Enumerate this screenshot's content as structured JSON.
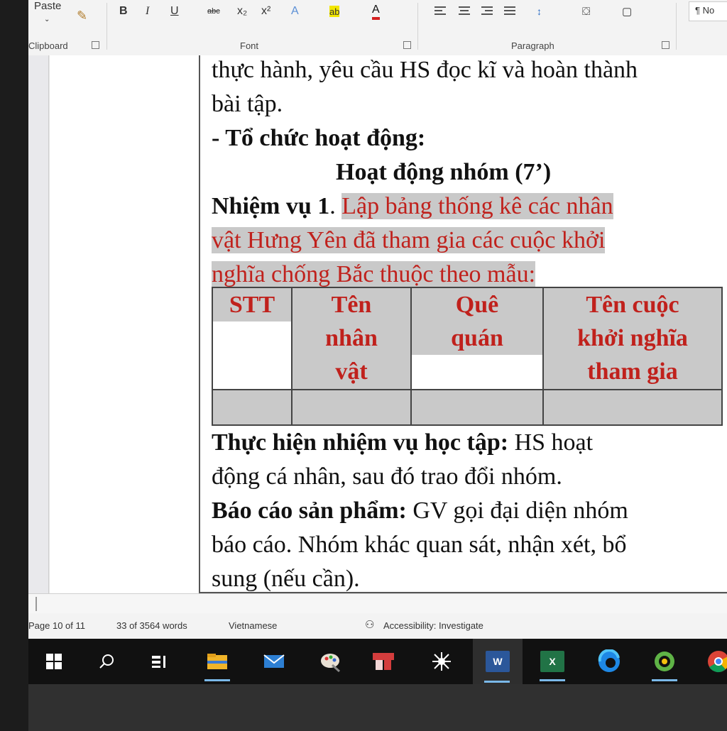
{
  "ribbon": {
    "paste_label": "Paste",
    "font_buttons": [
      "B",
      "I",
      "U",
      "abc",
      "x₂",
      "x²",
      "A",
      "ab",
      "A"
    ],
    "groups": {
      "clipboard": "Clipboard",
      "font": "Font",
      "paragraph": "Paragraph"
    },
    "styles_fragment": "¶ No"
  },
  "document": {
    "lines": [
      "thực hành, yêu cầu HS đọc kĩ và hoàn thành",
      "bài tập.",
      "- Tổ chức hoạt động:",
      "Hoạt động nhóm (7’)"
    ],
    "task_label": "Nhiệm vụ 1",
    "task_label_dot": ". ",
    "task_text_lines": [
      "Lập bảng thống kê các nhân",
      "vật Hưng Yên đã tham gia các cuộc khởi",
      "nghĩa chống Bắc thuộc theo mẫu:"
    ],
    "table": {
      "headers": [
        [
          "STT"
        ],
        [
          "Tên",
          "nhân",
          "vật"
        ],
        [
          "Quê",
          "quán"
        ],
        [
          "Tên cuộc",
          "khởi nghĩa",
          "tham gia"
        ]
      ]
    },
    "perform_label": "Thực hiện nhiệm vụ học tập:",
    "perform_text": " HS hoạt",
    "perform_text_2": "động cá nhân, sau đó trao đổi nhóm.",
    "report_label": "Báo cáo sản phẩm:",
    "report_text": " GV gọi đại diện nhóm",
    "report_text_2": "báo cáo. Nhóm khác quan sát, nhận xét, bổ",
    "report_text_3": "sung (nếu cần)."
  },
  "status_bar": {
    "page": "Page 10 of 11",
    "words": "33 of 3564 words",
    "language": "Vietnamese",
    "accessibility": "Accessibility: Investigate"
  },
  "taskbar": {
    "items": [
      "start-icon",
      "search-icon",
      "task-view-icon",
      "file-explorer-icon",
      "mail-icon",
      "paint-icon",
      "snipping-icon",
      "settings-burst-icon",
      "word-icon",
      "excel-icon",
      "edge-icon",
      "maps-icon",
      "chrome-icon"
    ],
    "word_letter": "W",
    "excel_letter": "X"
  },
  "colors": {
    "red_text": "#c0211c",
    "highlight": "#c9c9c9",
    "word_blue": "#2b579a",
    "excel_green": "#217346"
  }
}
